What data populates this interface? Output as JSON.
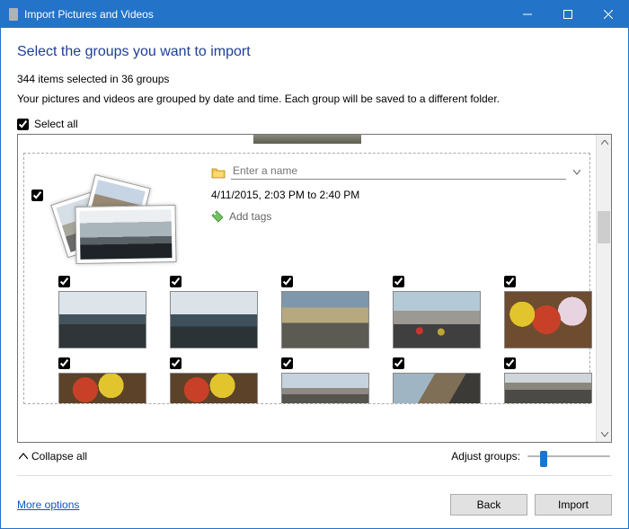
{
  "window": {
    "title": "Import Pictures and Videos"
  },
  "heading": "Select the groups you want to import",
  "summary": "344 items selected in 36 groups",
  "help_text": "Your pictures and videos are grouped by date and time. Each group will be saved to a different folder.",
  "select_all": {
    "label": "Select all",
    "checked": true
  },
  "group": {
    "checked": true,
    "name_placeholder": "Enter a name",
    "name_value": "",
    "date_range": "4/11/2015, 2:03 PM to 2:40 PM",
    "add_tags": "Add tags"
  },
  "thumbnails": {
    "row1": [
      {
        "checked": true,
        "name": "photo-1",
        "cls": "t-sky"
      },
      {
        "checked": true,
        "name": "photo-2",
        "cls": "t-sky2"
      },
      {
        "checked": true,
        "name": "photo-3",
        "cls": "t-market"
      },
      {
        "checked": true,
        "name": "photo-4",
        "cls": "t-crowd"
      },
      {
        "checked": true,
        "name": "photo-5",
        "cls": "t-flowers"
      }
    ],
    "row2": [
      {
        "checked": true,
        "name": "photo-6",
        "cls": "t-flowers2"
      },
      {
        "checked": true,
        "name": "photo-7",
        "cls": "t-flowers2"
      },
      {
        "checked": true,
        "name": "photo-8",
        "cls": "t-tall"
      },
      {
        "checked": true,
        "name": "photo-9",
        "cls": "t-corner"
      },
      {
        "checked": true,
        "name": "photo-10",
        "cls": "t-street"
      }
    ]
  },
  "collapse_all": "Collapse all",
  "adjust_groups": "Adjust groups:",
  "more_options": "More options",
  "buttons": {
    "back": "Back",
    "import": "Import"
  }
}
